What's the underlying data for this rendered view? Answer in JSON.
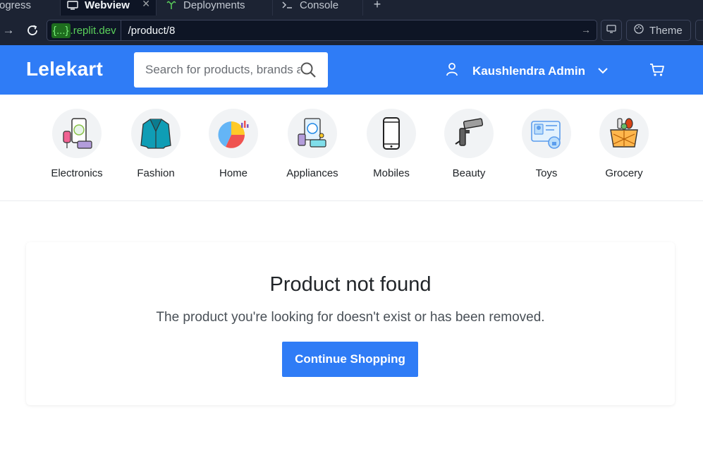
{
  "browser": {
    "tabs": [
      {
        "label": "rogress"
      },
      {
        "label": "Webview",
        "active": true
      },
      {
        "label": "Deployments"
      },
      {
        "label": "Console"
      }
    ],
    "new_tab": "+",
    "url_domain_braces": "{...}",
    "url_domain_suffix": ".replit.dev",
    "url_path": "/product/8",
    "theme_label": "Theme"
  },
  "header": {
    "logo": "Lelekart",
    "search_placeholder": "Search for products, brands and more",
    "user_name": "Kaushlendra Admin",
    "brand_color": "#2f7cf6"
  },
  "categories": [
    {
      "label": "Electronics",
      "icon": "electronics-icon"
    },
    {
      "label": "Fashion",
      "icon": "blazer-icon"
    },
    {
      "label": "Home",
      "icon": "pie-chart-icon"
    },
    {
      "label": "Appliances",
      "icon": "appliances-icon"
    },
    {
      "label": "Mobiles",
      "icon": "smartphone-icon"
    },
    {
      "label": "Beauty",
      "icon": "hair-straightener-icon"
    },
    {
      "label": "Toys",
      "icon": "id-card-icon"
    },
    {
      "label": "Grocery",
      "icon": "grocery-basket-icon"
    }
  ],
  "not_found": {
    "title": "Product not found",
    "message": "The product you're looking for doesn't exist or has been removed.",
    "button": "Continue Shopping"
  }
}
